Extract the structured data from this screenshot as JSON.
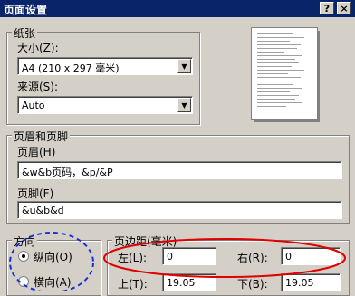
{
  "window": {
    "title": "页面设置",
    "help_btn": "?",
    "close_btn": "×"
  },
  "paper": {
    "group_label": "纸张",
    "size_label": "大小(Z):",
    "size_value": "A4 (210 x 297 毫米)",
    "source_label": "来源(S):",
    "source_value": "Auto"
  },
  "header_footer": {
    "group_label": "页眉和页脚",
    "header_label": "页眉(H)",
    "header_value": "&w&b页码，&p/&P",
    "footer_label": "页脚(F)",
    "footer_value": "&u&b&d"
  },
  "orientation": {
    "group_label": "方向",
    "portrait_label": "纵向(O)",
    "landscape_label": "横向(A)",
    "selected": "portrait"
  },
  "margins": {
    "group_label": "页边距(毫米)",
    "left_label": "左(L):",
    "left_value": "0",
    "right_label": "右(R):",
    "right_value": "0",
    "top_label": "上(T):",
    "top_value": "19.05",
    "bottom_label": "下(B):",
    "bottom_value": "19.05"
  },
  "colors": {
    "titlebar": "#0a246a",
    "annotation_red": "#e00000",
    "annotation_blue": "#1a2fd6"
  }
}
